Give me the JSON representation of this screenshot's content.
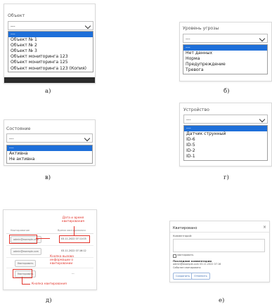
{
  "panel_a": {
    "label": "Объект",
    "selected": "---",
    "options": [
      "---",
      "Объект № 1",
      "Объект № 2",
      "Объект № 3",
      "Объект мониторинга 123",
      "Объект мониторинга 125",
      "Объект мониторинга 123 (Копия)"
    ],
    "caption": "а)"
  },
  "panel_b": {
    "label": "Уровень угрозы",
    "selected": "---",
    "options": [
      "---",
      "Нет данных",
      "Норма",
      "Предупреждение",
      "Тревога"
    ],
    "caption": "б)"
  },
  "panel_v": {
    "label": "Состояние",
    "selected": "---",
    "options": [
      "---",
      "Активна",
      "Не активна"
    ],
    "caption": "в)"
  },
  "panel_g": {
    "label": "Устройство",
    "selected": "---",
    "options": [
      "---",
      "Датчик струнный",
      "ID-6",
      "ID-5",
      "ID-2",
      "ID-1"
    ],
    "caption": "г)"
  },
  "panel_d": {
    "header_left": "Квитирование",
    "header_right": "Время квитирования",
    "rows": [
      {
        "user": "admin@example.com",
        "time": "03.11.2022 07:11:03"
      },
      {
        "user": "admin@example.com",
        "time": "03.11.2022 07:16:12"
      },
      {
        "user": "Квитировать",
        "time": ""
      },
      {
        "user": "Квитировать",
        "time": "---"
      }
    ],
    "ann_datetime": "Дата и время квитирования",
    "ann_info": "Кнопка вызова информации о квитировании",
    "ann_ack": "Кнопка квитирования",
    "caption": "д)"
  },
  "panel_e": {
    "title": "Квитировано",
    "comment_label": "Комментарий:",
    "checkbox_label": "квитировать",
    "last_comments_title": "Последние комментарии",
    "last_comment_line": "admin@example.com 03.11.2022 07:16",
    "last_comment_text": "Событие квитировано",
    "save_btn": "Сохранить",
    "cancel_btn": "Отменить",
    "caption": "е)"
  }
}
